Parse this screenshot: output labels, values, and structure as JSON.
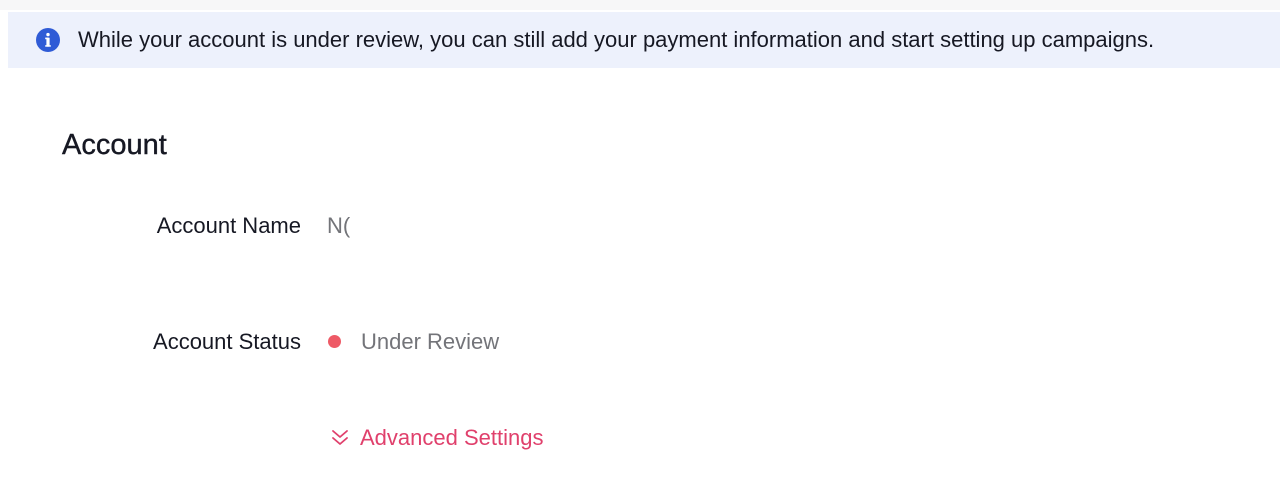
{
  "banner": {
    "icon": "info-icon",
    "icon_color": "#2f5bd6",
    "background": "#edf1fc",
    "message": "While your account is under review, you can still add your payment information and start setting up campaigns."
  },
  "account": {
    "title": "Account",
    "name_label": "Account Name",
    "name_value": "N(",
    "status_label": "Account Status",
    "status_value": "Under Review",
    "status_color": "#ee5a66",
    "advanced_settings_label": "Advanced Settings",
    "advanced_settings_icon": "double-chevron-down-icon",
    "accent_color": "#e0406c"
  }
}
